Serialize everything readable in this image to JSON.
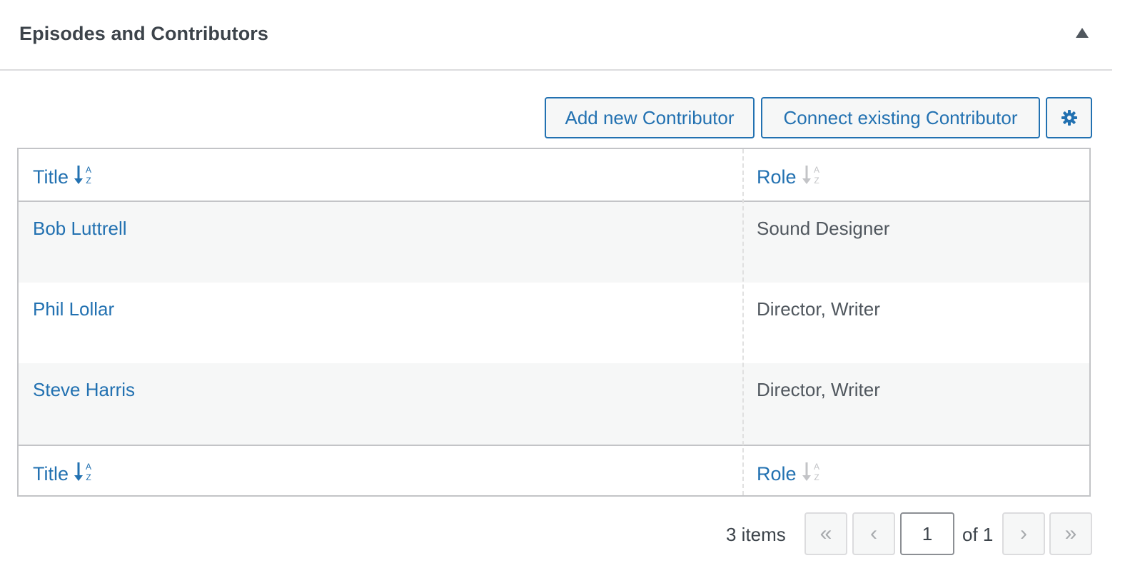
{
  "panel": {
    "title": "Episodes and Contributors"
  },
  "toolbar": {
    "add_label": "Add new Contributor",
    "connect_label": "Connect existing Contributor",
    "settings_icon": "gear-icon"
  },
  "table": {
    "headers": {
      "title": "Title",
      "role": "Role"
    },
    "footers": {
      "title": "Title",
      "role": "Role"
    },
    "sort": {
      "title": "active-asc",
      "role": "inactive"
    },
    "rows": [
      {
        "title": "Bob Luttrell",
        "role": "Sound Designer"
      },
      {
        "title": "Phil Lollar",
        "role": "Director, Writer"
      },
      {
        "title": "Steve Harris",
        "role": "Director, Writer"
      }
    ]
  },
  "pagination": {
    "items_count": "3 items",
    "first": "«",
    "prev": "‹",
    "current_page": "1",
    "of_pages": "of 1",
    "next": "›",
    "last": "»"
  },
  "colors": {
    "accent": "#2271b1",
    "text": "#3c434a",
    "border": "#c3c4c7",
    "row_alt": "#f6f7f7"
  }
}
